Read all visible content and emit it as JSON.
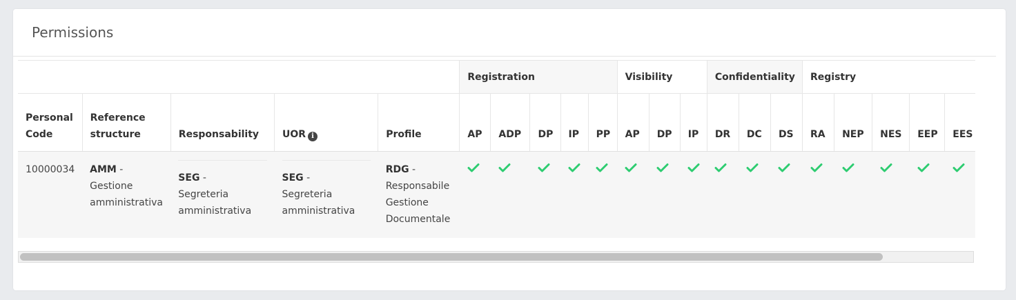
{
  "panel": {
    "title": "Permissions"
  },
  "groups": {
    "registration": "Registration",
    "visibility": "Visibility",
    "confidentiality": "Confidentiality",
    "registry": "Registry"
  },
  "headers": {
    "personal_code": [
      "Personal",
      "Code"
    ],
    "reference_structure": [
      "Reference",
      "structure"
    ],
    "responsability": "Responsability",
    "uor": "UOR",
    "profile": "Profile",
    "registration": [
      "AP",
      "ADP",
      "DP",
      "IP",
      "PP"
    ],
    "visibility": [
      "AP",
      "DP",
      "IP"
    ],
    "confidentiality": [
      "DR",
      "DC",
      "DS"
    ],
    "registry": [
      "RA",
      "NEP",
      "NES",
      "EEP",
      "EES"
    ]
  },
  "row": {
    "personal_code": "10000034",
    "reference_structure": {
      "code": "AMM",
      "sep": " -",
      "line1": "Gestione",
      "line2": "amministrativa"
    },
    "responsability": {
      "code": "SEG",
      "sep": " -",
      "line1": "Segreteria",
      "line2": "amministrativa"
    },
    "uor": {
      "code": "SEG",
      "sep": " -",
      "line1": "Segreteria",
      "line2": "amministrativa"
    },
    "profile": {
      "code": "RDG",
      "sep": " -",
      "line1": "Responsabile",
      "line2": "Gestione",
      "line3": "Documentale"
    },
    "permissions_granted": 16
  },
  "icons": {
    "info": "info-circle-icon",
    "check": "check-icon",
    "info_glyph": "i"
  },
  "colors": {
    "check": "#2ecc71",
    "row_bg": "#f6f6f6",
    "scroll_thumb": "#c1c1c1"
  }
}
